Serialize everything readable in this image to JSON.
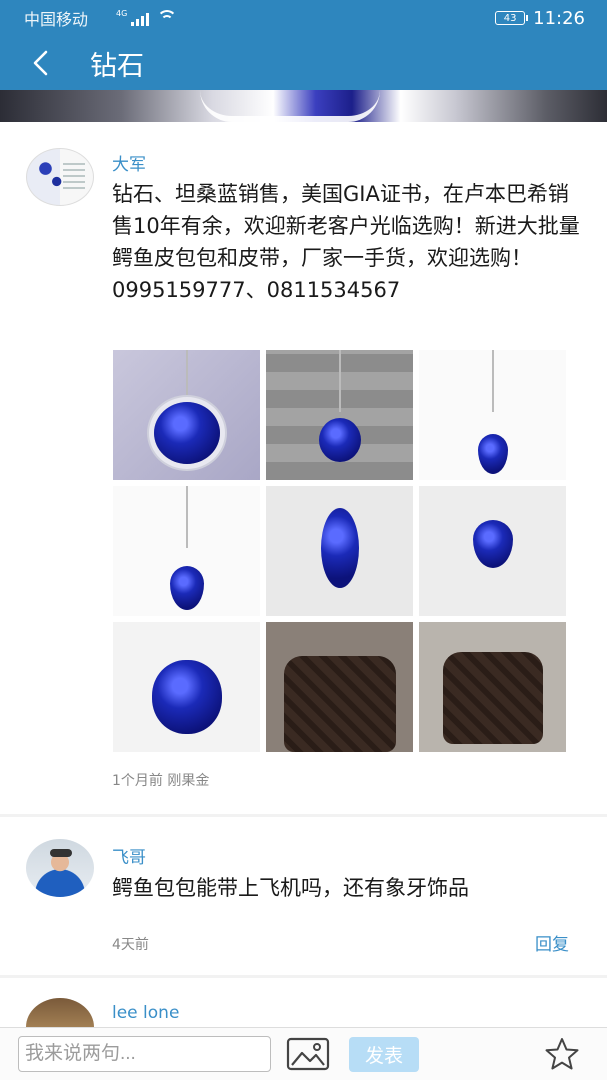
{
  "status": {
    "carrier": "中国移动",
    "network": "4G",
    "battery": "43",
    "time": "11:26"
  },
  "header": {
    "title": "钻石"
  },
  "post": {
    "author": "大军",
    "text": "钻石、坦桑蓝销售，美国GIA证书，在卢本巴希销售10年有余，欢迎新老客户光临选购！新进大批量鳄鱼皮包包和皮带，厂家一手货，欢迎选购！0995159777、0811534567",
    "meta": "1个月前 刚果金"
  },
  "replies": [
    {
      "author": "飞哥",
      "text": "鳄鱼包包能带上飞机吗，还有象牙饰品",
      "time": "4天前",
      "reply_label": "回复"
    },
    {
      "author": "lee lone"
    }
  ],
  "composer": {
    "placeholder": "我来说两句...",
    "send_label": "发表"
  },
  "icons": {
    "back": "back-arrow-icon",
    "image": "image-icon",
    "favorite": "star-icon"
  },
  "colors": {
    "primary": "#2e86be",
    "link": "#3a8fc8",
    "send_bg": "#b7ddf6"
  }
}
